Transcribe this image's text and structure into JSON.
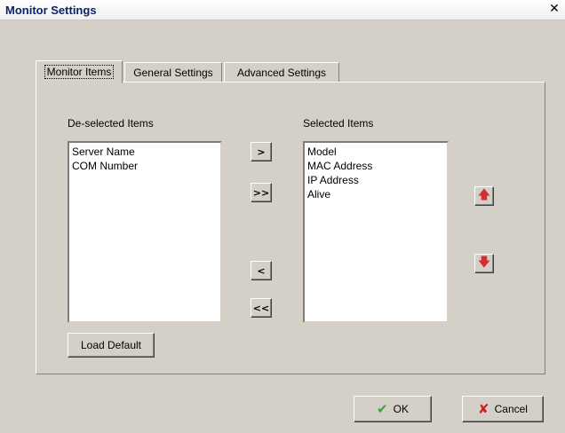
{
  "window": {
    "title": "Monitor Settings",
    "close_glyph": "✕"
  },
  "tabs": [
    {
      "label": "Monitor Items",
      "active": true
    },
    {
      "label": "General Settings",
      "active": false
    },
    {
      "label": "Advanced Settings",
      "active": false
    }
  ],
  "deselected": {
    "label": "De-selected Items",
    "items": [
      "Server Name",
      "COM Number"
    ]
  },
  "selected": {
    "label": "Selected Items",
    "items": [
      "Model",
      "MAC Address",
      "IP Address",
      "Alive"
    ]
  },
  "transfer_buttons": {
    "add_one": ">",
    "add_all": ">>",
    "remove_one": "<",
    "remove_all": "<<"
  },
  "order_buttons": {
    "up_icon": "arrow-up-icon",
    "down_icon": "arrow-down-icon"
  },
  "load_default_label": "Load Default",
  "footer": {
    "ok_label": "OK",
    "cancel_label": "Cancel"
  },
  "colors": {
    "dialog_bg": "#d4d0c8",
    "title_text": "#0a246a",
    "arrow_red": "#d03030",
    "ok_green": "#3aa63a",
    "cancel_red": "#d02020"
  }
}
